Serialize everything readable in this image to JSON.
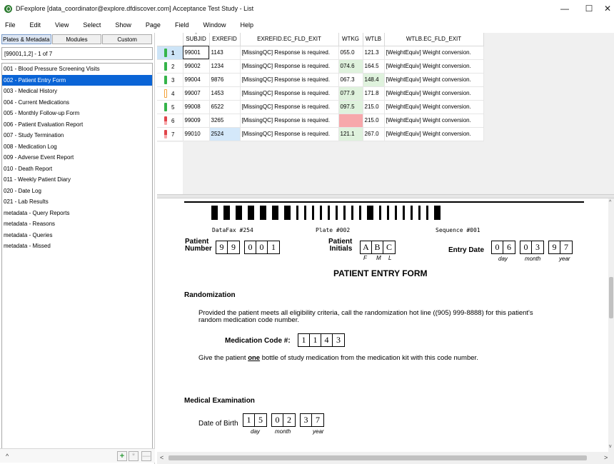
{
  "window": {
    "title": "DFexplore [data_coordinator@explore.dfdiscover.com] Acceptance Test Study - List",
    "min": "—",
    "max": "☐",
    "close": "✕"
  },
  "menu": [
    "File",
    "Edit",
    "View",
    "Select",
    "Show",
    "Page",
    "Field",
    "Window",
    "Help"
  ],
  "left": {
    "tabs": [
      "Plates & Metadata",
      "Modules",
      "Custom"
    ],
    "record_info": "[99001,1,2] - 1 of 7",
    "plates": [
      "001 - Blood Pressure Screening Visits",
      "002 - Patient Entry Form",
      "003 - Medical History",
      "004 - Current Medications",
      "005 - Monthly Follow-up Form",
      "006 - Patient Evaluation Report",
      "007 - Study Termination",
      "008 - Medication Log",
      "009 - Adverse Event Report",
      "010 - Death Report",
      "011 - Weekly Patient Diary",
      "020 - Date Log",
      "021 - Lab Results",
      "metadata - Query Reports",
      "metadata - Reasons",
      "metadata - Queries",
      "metadata - Missed"
    ],
    "selected_index": 1,
    "bottom": {
      "up": "^",
      "add": "+",
      "star": "*",
      "minus": "—"
    }
  },
  "grid": {
    "columns": [
      "",
      "SUBJID",
      "EXREFID",
      "EXREFID.EC_FLD_EXIT",
      "WTKG",
      "WTLB",
      "WTLB.EC_FLD_EXIT"
    ],
    "rows": [
      {
        "n": "1",
        "status": "#35b44a",
        "subjid": "99001",
        "exrefid": "1143",
        "ec": "[MissingQC] Response is required.",
        "wtkg": "055.0",
        "wtlb": "121.3",
        "wtlbec": "[WeightEquiv] Weight conversion."
      },
      {
        "n": "2",
        "status": "#35b44a",
        "subjid": "99002",
        "exrefid": "1234",
        "ec": "[MissingQC] Response is required.",
        "wtkg": "074.6",
        "wtlb": "164.5",
        "wtlbec": "[WeightEquiv] Weight conversion."
      },
      {
        "n": "3",
        "status": "#35b44a",
        "subjid": "99004",
        "exrefid": "9876",
        "ec": "[MissingQC] Response is required.",
        "wtkg": "067.3",
        "wtlb": "148.4",
        "wtlbec": "[WeightEquiv] Weight conversion."
      },
      {
        "n": "4",
        "status": "#f3a23a",
        "subjid": "99007",
        "exrefid": "1453",
        "ec": "[MissingQC] Response is required.",
        "wtkg": "077.9",
        "wtlb": "171.8",
        "wtlbec": "[WeightEquiv] Weight conversion."
      },
      {
        "n": "5",
        "status": "#35b44a",
        "subjid": "99008",
        "exrefid": "6522",
        "ec": "[MissingQC] Response is required.",
        "wtkg": "097.5",
        "wtlb": "215.0",
        "wtlbec": "[WeightEquiv] Weight conversion."
      },
      {
        "n": "6",
        "status": "#e0444a",
        "subjid": "99009",
        "exrefid": "3265",
        "ec": "[MissingQC] Response is required.",
        "wtkg": "",
        "wtlb": "215.0",
        "wtlbec": "[WeightEquiv] Weight conversion."
      },
      {
        "n": "7",
        "status": "#e0444a",
        "subjid": "99010",
        "exrefid": "2524",
        "ec": "[MissingQC] Response is required.",
        "wtkg": "121.1",
        "wtlb": "267.0",
        "wtlbec": "[WeightEquiv] Weight conversion."
      }
    ]
  },
  "form": {
    "header_left": "DataFax #254",
    "header_mid": "Plate #002",
    "header_right": "Sequence #001",
    "patient_number_label_1": "Patient",
    "patient_number_label_2": "Number",
    "patient_number_a": [
      "9",
      "9"
    ],
    "patient_number_b": [
      "0",
      "0",
      "1"
    ],
    "initials_label_1": "Patient",
    "initials_label_2": "Initials",
    "initials": [
      "A",
      "B",
      "C"
    ],
    "initials_sub": [
      "F",
      "M",
      "L"
    ],
    "entry_date_label": "Entry Date",
    "entry_day": [
      "0",
      "6"
    ],
    "entry_month": [
      "0",
      "3"
    ],
    "entry_year": [
      "9",
      "7"
    ],
    "day_label": "day",
    "month_label": "month",
    "year_label": "year",
    "title": "PATIENT ENTRY FORM",
    "randomization_heading": "Randomization",
    "randomization_text_1": "Provided the patient meets all eligibility criteria, call the randomization hot line ((905) 999-8888) for this patient's",
    "randomization_text_2": "random medication code number.",
    "medication_code_label": "Medication Code #:",
    "medication_code": [
      "1",
      "1",
      "4",
      "3"
    ],
    "give_text_1": "Give the patient",
    "give_text_one": "one",
    "give_text_2": "bottle of study medication from the medication kit with this code number.",
    "medical_heading": "Medical Examination",
    "dob_label": "Date of Birth",
    "dob_day": [
      "1",
      "5"
    ],
    "dob_month": [
      "0",
      "2"
    ],
    "dob_year": [
      "3",
      "7"
    ]
  }
}
